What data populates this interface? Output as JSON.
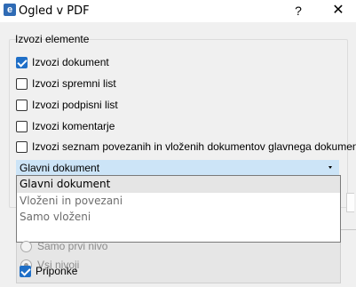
{
  "window": {
    "app_icon_letter": "e",
    "title": "Ogled v PDF",
    "help_glyph": "?",
    "close_glyph": "✕"
  },
  "group": {
    "title": "Izvozi elemente",
    "checkboxes": [
      {
        "label": "Izvozi dokument",
        "checked": true
      },
      {
        "label": "Izvozi spremni list",
        "checked": false
      },
      {
        "label": "Izvozi podpisni list",
        "checked": false
      },
      {
        "label": "Izvozi komentarje",
        "checked": false
      },
      {
        "label": "Izvozi seznam povezanih in vloženih dokumentov glavnega dokumenta",
        "checked": false
      }
    ]
  },
  "combo": {
    "selected_value": "Glavni dokument",
    "options": [
      {
        "label": "Glavni dokument",
        "selected": true
      },
      {
        "label": "Vloženi in povezani",
        "selected": false
      },
      {
        "label": "Samo vloženi",
        "selected": false
      }
    ]
  },
  "lower": {
    "radios": [
      {
        "label": "Samo prvi nivo",
        "checked": false
      },
      {
        "label": "Vsi nivoji",
        "checked": true
      }
    ],
    "attachments": {
      "label": "Priponke",
      "checked": true
    }
  },
  "colors": {
    "accent": "#1f6fc7",
    "combo_highlight": "#cce4f7",
    "selected_item": "#e5e5e5"
  }
}
